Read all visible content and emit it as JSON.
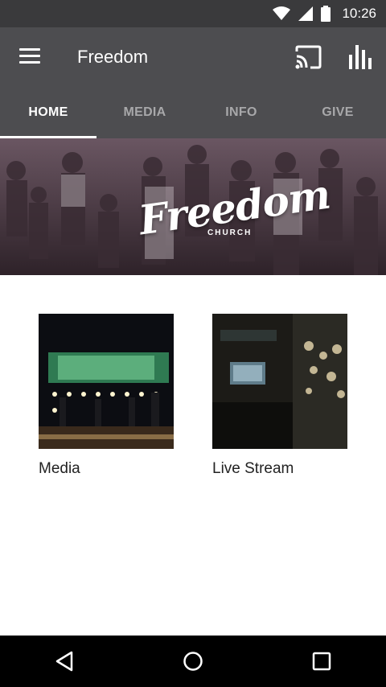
{
  "status_bar": {
    "time": "10:26"
  },
  "app_bar": {
    "title": "Freedom"
  },
  "tabs": [
    {
      "label": "HOME",
      "active": true
    },
    {
      "label": "MEDIA",
      "active": false
    },
    {
      "label": "INFO",
      "active": false
    },
    {
      "label": "GIVE",
      "active": false
    }
  ],
  "hero": {
    "logo_text": "Freedom",
    "logo_sub": "CHURCH"
  },
  "cards": [
    {
      "label": "Media",
      "icon": "stage-photo"
    },
    {
      "label": "Live Stream",
      "icon": "live-stream-photo"
    }
  ],
  "nav_bar": {
    "buttons": [
      "back-icon",
      "home-icon",
      "recents-icon"
    ]
  },
  "colors": {
    "status_bar": "#3a3a3c",
    "app_bar": "#4d4d50",
    "tab_inactive": "#a8a8aa",
    "tab_active": "#ffffff"
  }
}
